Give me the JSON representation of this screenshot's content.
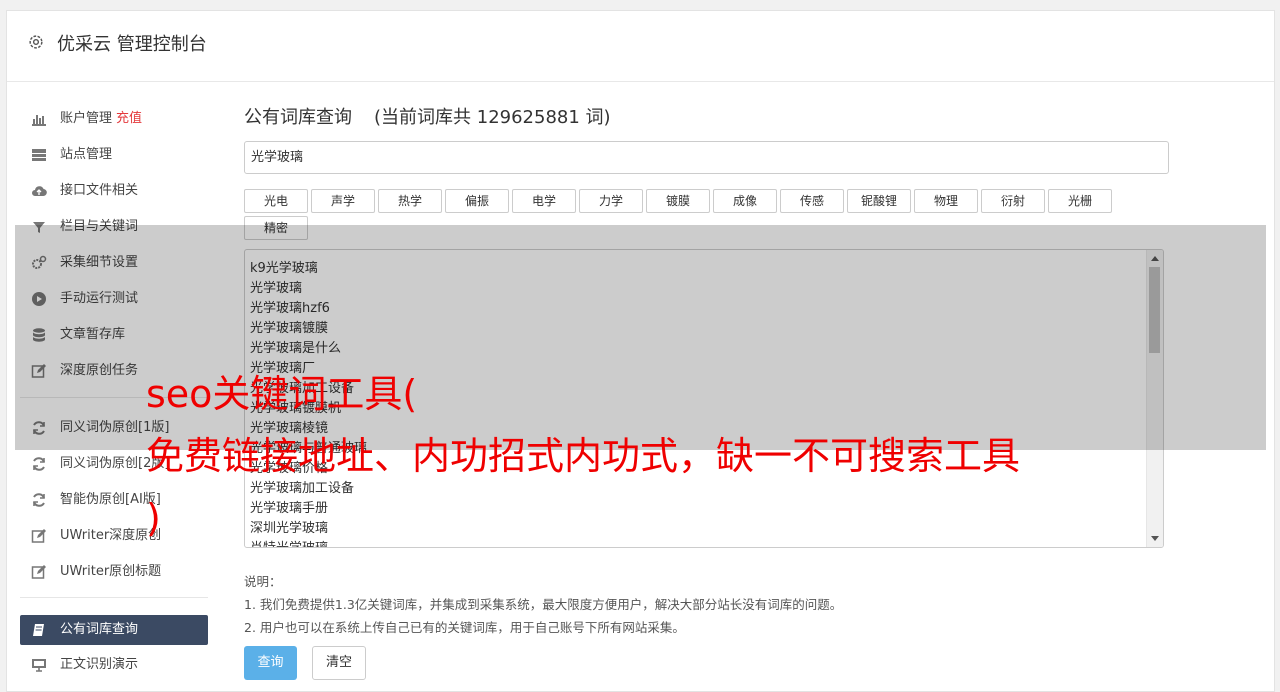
{
  "header": {
    "title": "优采云 管理控制台"
  },
  "sidebar": {
    "items": [
      {
        "label": "账户管理",
        "badge": "充值",
        "icon": "bar-chart-icon"
      },
      {
        "label": "站点管理",
        "icon": "server-icon"
      },
      {
        "label": "接口文件相关",
        "icon": "cloud-upload-icon"
      },
      {
        "label": "栏目与关键词",
        "icon": "filter-icon"
      },
      {
        "label": "采集细节设置",
        "icon": "gears-icon"
      },
      {
        "label": "手动运行测试",
        "icon": "play-circle-icon"
      },
      {
        "label": "文章暂存库",
        "icon": "database-icon"
      },
      {
        "label": "深度原创任务",
        "icon": "edit-icon"
      },
      {
        "label": "同义词伪原创[1版]",
        "icon": "refresh-icon"
      },
      {
        "label": "同义词伪原创[2版]",
        "icon": "refresh-icon"
      },
      {
        "label": "智能伪原创[AI版]",
        "icon": "refresh-icon"
      },
      {
        "label": "UWriter深度原创",
        "icon": "edit-icon"
      },
      {
        "label": "UWriter原创标题",
        "icon": "edit-icon"
      },
      {
        "label": "公有词库查询",
        "icon": "book-icon",
        "active": true
      },
      {
        "label": "正文识别演示",
        "icon": "monitor-icon"
      }
    ]
  },
  "main": {
    "title": "公有词库查询",
    "count_text": "(当前词库共 129625881 词)",
    "search_value": "光学玻璃",
    "tags": [
      "光电",
      "声学",
      "热学",
      "偏振",
      "电学",
      "力学",
      "镀膜",
      "成像",
      "传感",
      "铌酸锂",
      "物理",
      "衍射",
      "光栅",
      "精密"
    ],
    "results": [
      "k9光学玻璃",
      "光学玻璃",
      "光学玻璃hzf6",
      "光学玻璃镀膜",
      "光学玻璃是什么",
      "光学玻璃厂",
      "光学玻璃加工设备",
      "光学玻璃镀膜机",
      "光学玻璃棱镜",
      "光学玻璃与普通玻璃",
      "光学玻璃价格",
      "光学玻璃加工设备",
      "光学玻璃手册",
      "深圳光学玻璃",
      "肖特光学玻璃"
    ],
    "notes": {
      "heading": "说明：",
      "line1": "1. 我们免费提供1.3亿关键词库，并集成到采集系统，最大限度方便用户，解决大部分站长没有词库的问题。",
      "line2": "2. 用户也可以在系统上传自己已有的关键词库，用于自己账号下所有网站采集。"
    },
    "buttons": {
      "query": "查询",
      "clear": "清空"
    }
  },
  "overlay": {
    "line1": "seo关键词工具(",
    "line2": "免费链接地址、内功招式内功式，缺一不可搜索工具",
    "line3": ")",
    "color": "#ef0000"
  }
}
